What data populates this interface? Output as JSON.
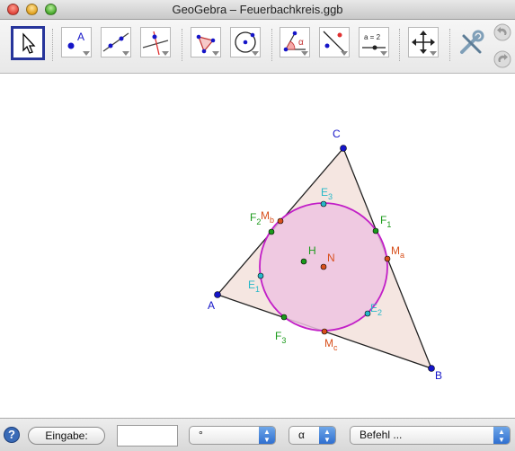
{
  "window": {
    "title": "GeoGebra – Feuerbachkreis.ggb"
  },
  "toolbar": {
    "tools": [
      {
        "name": "move-tool",
        "icon": "arrow-cursor-icon"
      },
      {
        "name": "point-tool",
        "icon": "point-icon",
        "label": "A"
      },
      {
        "name": "line-tool",
        "icon": "line-through-two-points-icon"
      },
      {
        "name": "perpendicular-tool",
        "icon": "perpendicular-line-icon"
      },
      {
        "name": "polygon-tool",
        "icon": "polygon-icon"
      },
      {
        "name": "circle-tool",
        "icon": "circle-icon"
      },
      {
        "name": "angle-tool",
        "icon": "angle-icon",
        "label": "α"
      },
      {
        "name": "reflect-tool",
        "icon": "reflect-icon"
      },
      {
        "name": "slider-tool",
        "icon": "slider-icon",
        "label": "a = 2"
      },
      {
        "name": "move-view-tool",
        "icon": "move-arrows-icon"
      }
    ],
    "settings_icon": "wrench-screwdriver-icon",
    "undo_icon": "undo-icon",
    "redo_icon": "redo-icon"
  },
  "graphics": {
    "vertices": [
      {
        "label": "A"
      },
      {
        "label": "B"
      },
      {
        "label": "C"
      }
    ],
    "points": [
      {
        "label": "N"
      },
      {
        "label": "H"
      },
      {
        "label": "E",
        "sub": "1"
      },
      {
        "label": "E",
        "sub": "2"
      },
      {
        "label": "E",
        "sub": "3"
      },
      {
        "label": "F",
        "sub": "1"
      },
      {
        "label": "F",
        "sub": "2"
      },
      {
        "label": "F",
        "sub": "3"
      },
      {
        "label": "M",
        "sub": "a"
      },
      {
        "label": "M",
        "sub": "b"
      },
      {
        "label": "M",
        "sub": "c"
      }
    ],
    "colors": {
      "triangle_fill": "#f5e6e1",
      "circle_fill": "#edc3e0",
      "circle_stroke": "#c21fc7",
      "vertex": "#1515c8",
      "midpoint": "#d8501c",
      "altitude_foot": "#1a9a1a",
      "euler_point": "#26b8c8"
    }
  },
  "inputbar": {
    "help_label": "?",
    "input_button": "Eingabe:",
    "input_value": "",
    "degree_select": "°",
    "greek_select": "α",
    "command_select": "Befehl ..."
  }
}
